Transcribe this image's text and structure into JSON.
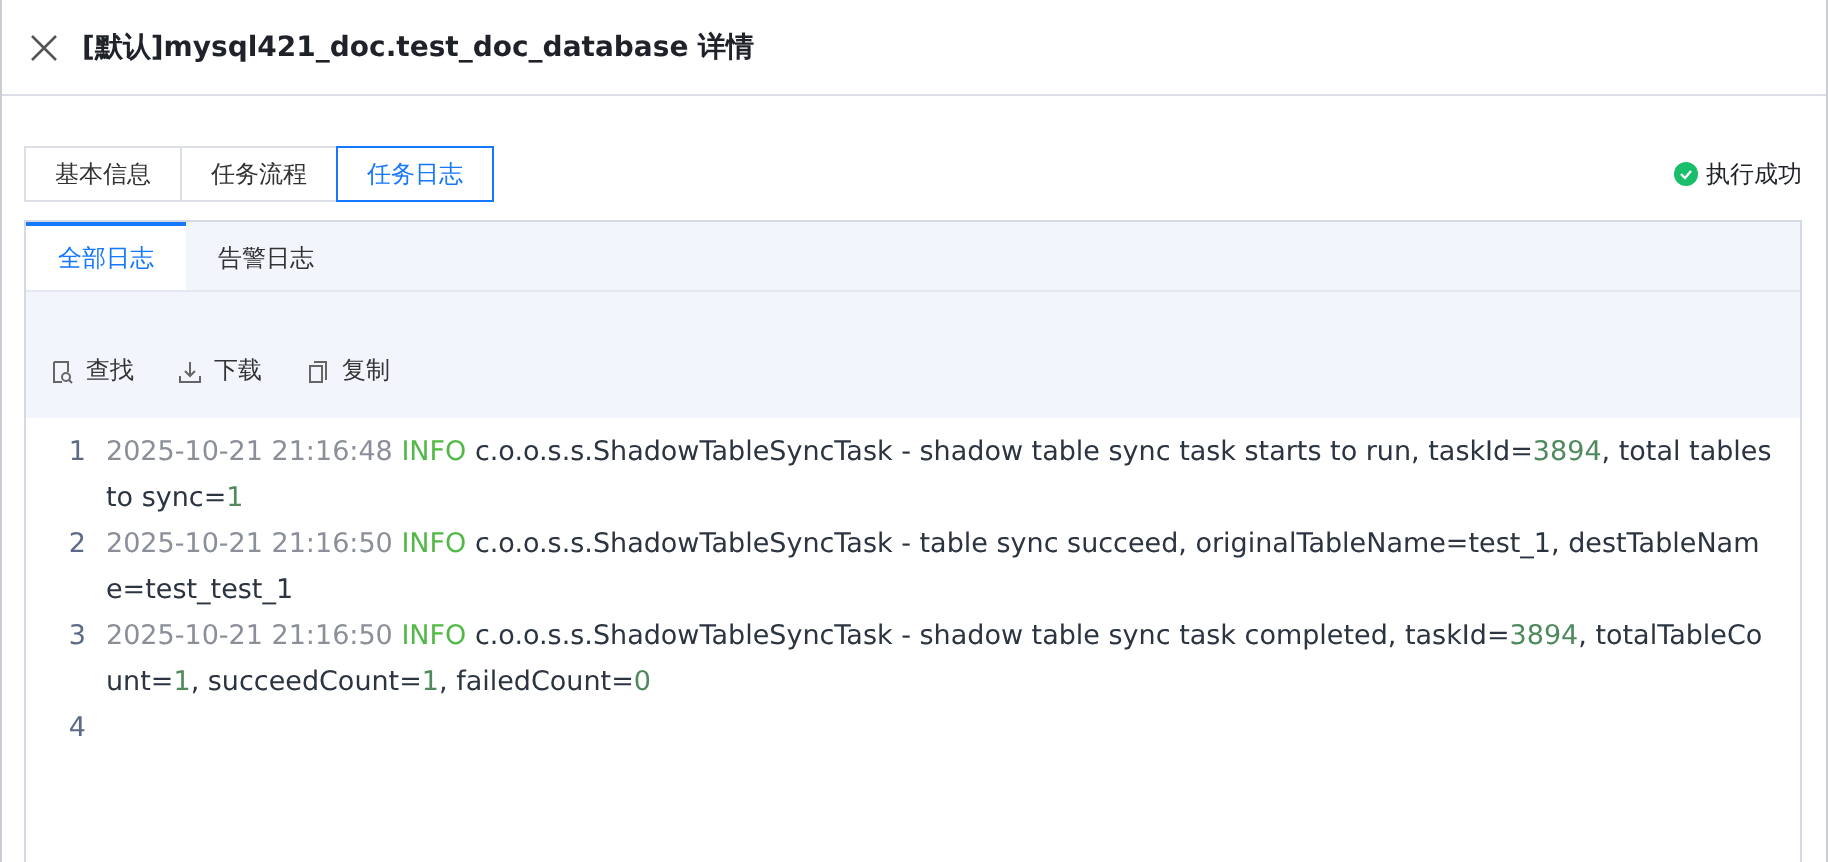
{
  "window": {
    "title": "[默认]mysql421_doc.test_doc_database 详情"
  },
  "tabs": [
    {
      "label": "基本信息",
      "selected": false
    },
    {
      "label": "任务流程",
      "selected": false
    },
    {
      "label": "任务日志",
      "selected": true
    }
  ],
  "status": {
    "label": "执行成功",
    "color": "#19be6b"
  },
  "log_tabs": [
    {
      "label": "全部日志",
      "selected": true
    },
    {
      "label": "告警日志",
      "selected": false
    }
  ],
  "toolbar": [
    {
      "kind": "search",
      "label": "查找"
    },
    {
      "kind": "download",
      "label": "下载"
    },
    {
      "kind": "copy",
      "label": "复制"
    }
  ],
  "log_lines": [
    {
      "number": "1",
      "segments": [
        {
          "kind": "time",
          "text": "2025-10-21 21:16:48"
        },
        {
          "kind": "level",
          "text": "INFO"
        },
        {
          "kind": "text",
          "text": "c.o.o.s.s.ShadowTableSyncTask - shadow table sync task starts to run, taskId="
        },
        {
          "kind": "num",
          "text": "3894"
        },
        {
          "kind": "text",
          "text": ", total tables to sync="
        },
        {
          "kind": "num",
          "text": "1"
        }
      ]
    },
    {
      "number": "2",
      "segments": [
        {
          "kind": "time",
          "text": "2025-10-21 21:16:50"
        },
        {
          "kind": "level",
          "text": "INFO"
        },
        {
          "kind": "text",
          "text": "c.o.o.s.s.ShadowTableSyncTask - table sync succeed, originalTableName=test_1, destTableName=test_test_1"
        }
      ]
    },
    {
      "number": "3",
      "segments": [
        {
          "kind": "time",
          "text": "2025-10-21 21:16:50"
        },
        {
          "kind": "level",
          "text": "INFO"
        },
        {
          "kind": "text",
          "text": "c.o.o.s.s.ShadowTableSyncTask - shadow table sync task completed, taskId="
        },
        {
          "kind": "num",
          "text": "3894"
        },
        {
          "kind": "text",
          "text": ", totalTableCount="
        },
        {
          "kind": "num",
          "text": "1"
        },
        {
          "kind": "text",
          "text": ", succeedCount="
        },
        {
          "kind": "num",
          "text": "1"
        },
        {
          "kind": "text",
          "text": ", failedCount="
        },
        {
          "kind": "num",
          "text": "0"
        }
      ]
    },
    {
      "number": "4"
    }
  ]
}
